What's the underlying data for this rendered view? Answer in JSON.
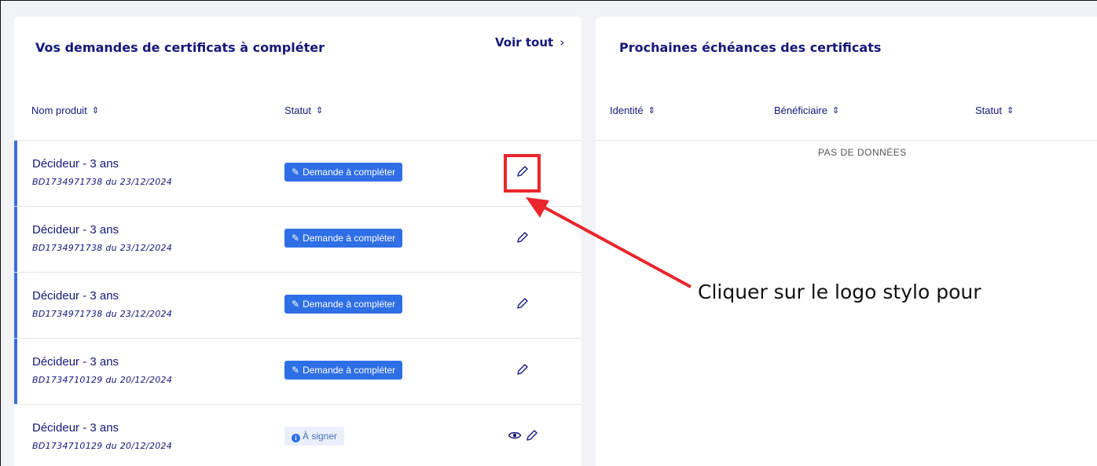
{
  "left_panel": {
    "title": "Vos demandes de certificats à compléter",
    "see_all_label": "Voir tout",
    "see_all_chevron": "›",
    "columns": {
      "product": "Nom produit",
      "status": "Statut"
    },
    "rows": [
      {
        "product": "Décideur - 3 ans",
        "reference": "BD1734971738 du 23/12/2024",
        "status": "Demande à compléter",
        "status_type": "complete",
        "actions": [
          "edit"
        ]
      },
      {
        "product": "Décideur - 3 ans",
        "reference": "BD1734971738 du 23/12/2024",
        "status": "Demande à compléter",
        "status_type": "complete",
        "actions": [
          "edit"
        ]
      },
      {
        "product": "Décideur - 3 ans",
        "reference": "BD1734971738 du 23/12/2024",
        "status": "Demande à compléter",
        "status_type": "complete",
        "actions": [
          "edit"
        ]
      },
      {
        "product": "Décideur - 3 ans",
        "reference": "BD1734710129 du 20/12/2024",
        "status": "Demande à compléter",
        "status_type": "complete",
        "actions": [
          "edit"
        ]
      },
      {
        "product": "Décideur - 3 ans",
        "reference": "BD1734710129 du 20/12/2024",
        "status": "À signer",
        "status_type": "sign",
        "actions": [
          "view",
          "edit"
        ]
      }
    ]
  },
  "right_panel": {
    "title": "Prochaines échéances des certificats",
    "columns": {
      "identity": "Identité",
      "beneficiary": "Bénéficiaire",
      "status": "Statut"
    },
    "empty_message": "PAS DE DONNÉES"
  },
  "annotation": {
    "text": "Cliquer sur le logo stylo pour",
    "color": "#e8262c"
  },
  "colors": {
    "accent": "#2f6fe6",
    "title": "#15177a",
    "row_accent": "#3b6fd9"
  },
  "icons": {
    "sort": "sort-icon",
    "edit": "pencil-icon",
    "view": "eye-icon",
    "info": "info-icon"
  }
}
